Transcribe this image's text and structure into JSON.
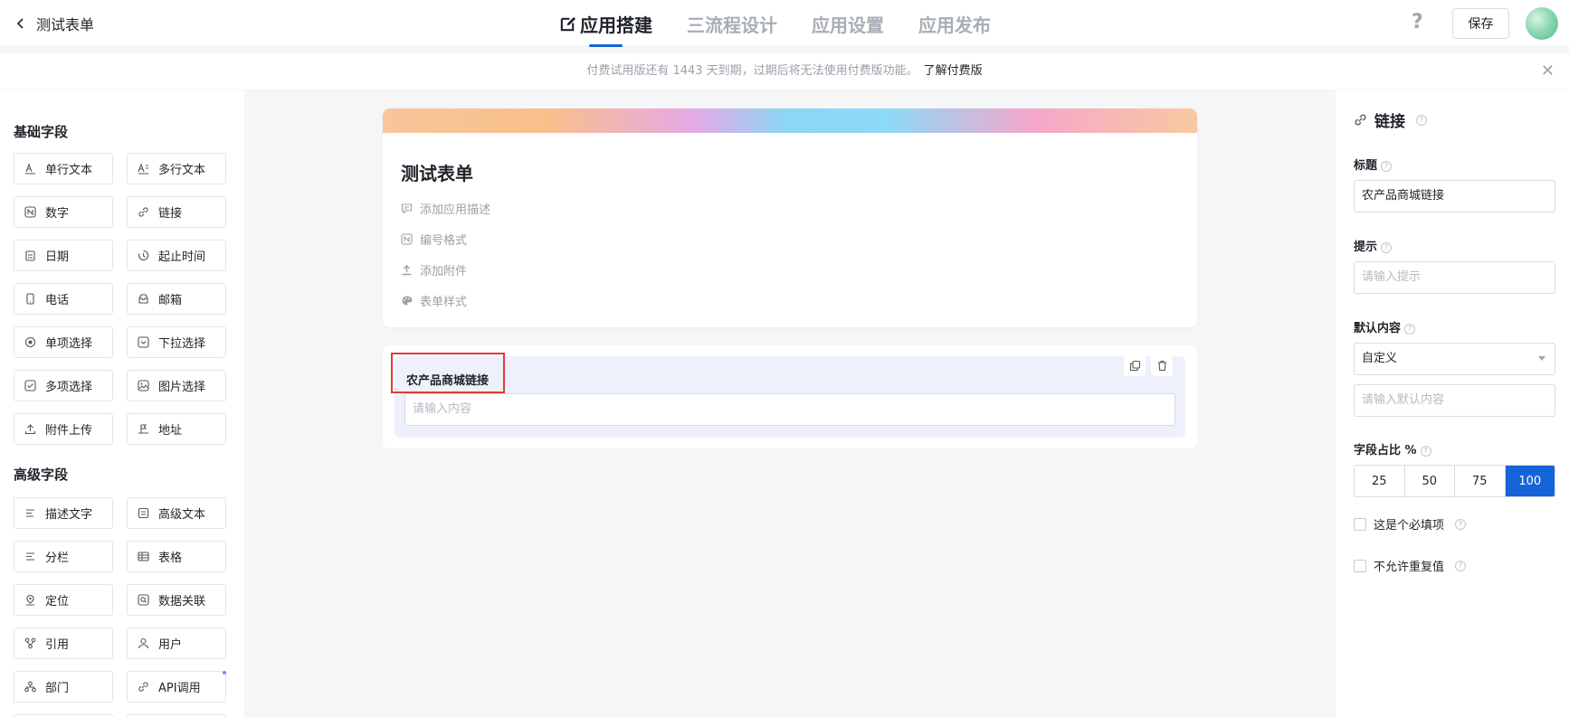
{
  "header": {
    "back_label": "测试表单",
    "tabs": [
      {
        "label": "应用搭建",
        "active": true
      },
      {
        "label": "三流程设计",
        "active": false
      },
      {
        "label": "应用设置",
        "active": false
      },
      {
        "label": "应用发布",
        "active": false
      }
    ],
    "help": "?",
    "save_label": "保存"
  },
  "notice": {
    "text": "付费试用版还有 1443 天到期，过期后将无法使用付费版功能。",
    "link": "了解付费版",
    "close": "✕"
  },
  "left_panel": {
    "basic_title": "基础字段",
    "basic_fields": [
      {
        "label": "单行文本",
        "icon": "single-line-text-icon"
      },
      {
        "label": "多行文本",
        "icon": "multi-line-text-icon"
      },
      {
        "label": "数字",
        "icon": "number-icon"
      },
      {
        "label": "链接",
        "icon": "link-icon"
      },
      {
        "label": "日期",
        "icon": "calendar-icon"
      },
      {
        "label": "起止时间",
        "icon": "time-range-icon"
      },
      {
        "label": "电话",
        "icon": "phone-icon"
      },
      {
        "label": "邮箱",
        "icon": "mail-icon"
      },
      {
        "label": "单项选择",
        "icon": "radio-icon"
      },
      {
        "label": "下拉选择",
        "icon": "dropdown-icon"
      },
      {
        "label": "多项选择",
        "icon": "checkbox-icon"
      },
      {
        "label": "图片选择",
        "icon": "image-icon"
      },
      {
        "label": "附件上传",
        "icon": "upload-icon"
      },
      {
        "label": "地址",
        "icon": "address-icon"
      }
    ],
    "advanced_title": "高级字段",
    "advanced_fields": [
      {
        "label": "描述文字",
        "icon": "description-icon"
      },
      {
        "label": "高级文本",
        "icon": "rich-text-icon"
      },
      {
        "label": "分栏",
        "icon": "columns-icon"
      },
      {
        "label": "表格",
        "icon": "table-icon"
      },
      {
        "label": "定位",
        "icon": "location-icon"
      },
      {
        "label": "数据关联",
        "icon": "data-link-icon"
      },
      {
        "label": "引用",
        "icon": "reference-icon"
      },
      {
        "label": "用户",
        "icon": "user-icon"
      },
      {
        "label": "部门",
        "icon": "department-icon"
      },
      {
        "label": "API调用",
        "icon": "api-icon"
      }
    ]
  },
  "canvas": {
    "form_title": "测试表单",
    "options": [
      {
        "label": "添加应用描述",
        "icon": "comment-icon"
      },
      {
        "label": "编号格式",
        "icon": "number-format-icon"
      },
      {
        "label": "添加附件",
        "icon": "attachment-upload-icon"
      },
      {
        "label": "表单样式",
        "icon": "palette-icon"
      }
    ],
    "field": {
      "label": "农产品商城链接",
      "placeholder": "请输入内容"
    }
  },
  "right_panel": {
    "title": "链接",
    "title_label": "标题",
    "title_value": "农产品商城链接",
    "hint_label": "提示",
    "hint_placeholder": "请输入提示",
    "default_label": "默认内容",
    "default_select": "自定义",
    "default_placeholder": "请输入默认内容",
    "ratio_label": "字段占比 %",
    "ratio_options": [
      "25",
      "50",
      "75",
      "100"
    ],
    "ratio_selected": "100",
    "required_label": "这是个必填项",
    "no_duplicate_label": "不允许重复值"
  },
  "colors": {
    "primary": "#1565d8",
    "highlight": "#e53935",
    "field_bg": "#eef1fb"
  }
}
